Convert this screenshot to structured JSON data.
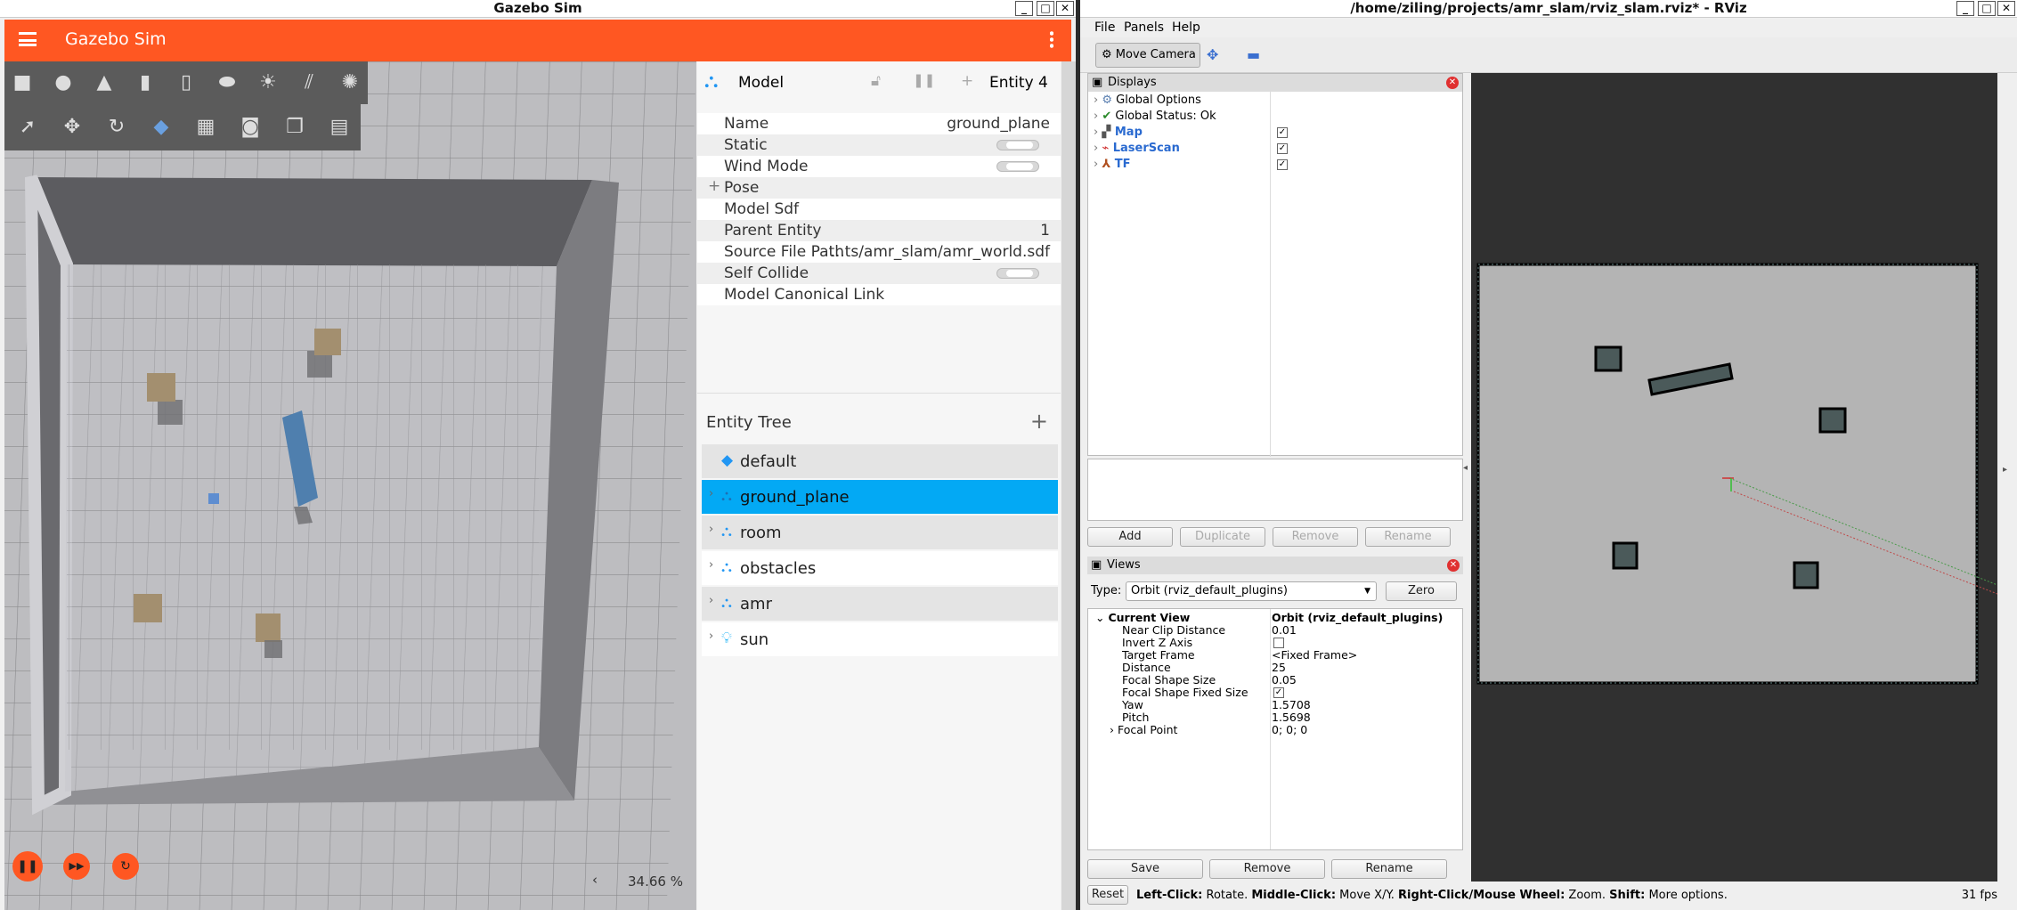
{
  "gazebo": {
    "window_title": "Gazebo Sim",
    "app_title": "Gazebo Sim",
    "zoom": "34.66 %",
    "props": {
      "header": "Model",
      "entity": "Entity 4",
      "rows": [
        {
          "key": "Name",
          "value": "ground_plane"
        },
        {
          "key": "Static",
          "value": ""
        },
        {
          "key": "Wind Mode",
          "value": ""
        },
        {
          "key": "Pose",
          "value": ""
        },
        {
          "key": "Model Sdf",
          "value": ""
        },
        {
          "key": "Parent Entity",
          "value": "1"
        },
        {
          "key": "Source File Path",
          "value": "...ts/amr_slam/amr_world.sdf"
        },
        {
          "key": "Self Collide",
          "value": ""
        },
        {
          "key": "Model Canonical Link",
          "value": ""
        }
      ]
    },
    "entity_tree": {
      "title": "Entity Tree",
      "items": [
        "default",
        "ground_plane",
        "room",
        "obstacles",
        "amr",
        "sun"
      ],
      "selected": "ground_plane"
    }
  },
  "rviz": {
    "window_title": "/home/ziling/projects/amr_slam/rviz_slam.rviz* - RViz",
    "menu": [
      "File",
      "Panels",
      "Help"
    ],
    "tool_move_camera": "Move Camera",
    "displays": {
      "title": "Displays",
      "items": [
        "Global Options",
        "Global Status: Ok",
        "Map",
        "LaserScan",
        "TF"
      ],
      "buttons": [
        "Add",
        "Duplicate",
        "Remove",
        "Rename"
      ]
    },
    "views": {
      "title": "Views",
      "type_label": "Type:",
      "type_value": "Orbit (rviz_default_plugins)",
      "zero": "Zero",
      "current_view": "Current View",
      "current_view_value": "Orbit (rviz_default_plugins)",
      "rows": [
        {
          "key": "Near Clip Distance",
          "value": "0.01"
        },
        {
          "key": "Invert Z Axis",
          "value": ""
        },
        {
          "key": "Target Frame",
          "value": "<Fixed Frame>"
        },
        {
          "key": "Distance",
          "value": "25"
        },
        {
          "key": "Focal Shape Size",
          "value": "0.05"
        },
        {
          "key": "Focal Shape Fixed Size",
          "value": ""
        },
        {
          "key": "Yaw",
          "value": "1.5708"
        },
        {
          "key": "Pitch",
          "value": "1.5698"
        },
        {
          "key": "Focal Point",
          "value": "0; 0; 0"
        }
      ],
      "buttons": [
        "Save",
        "Remove",
        "Rename"
      ]
    },
    "status": {
      "reset": "Reset",
      "b1": "Left-Click:",
      "t1": " Rotate. ",
      "b2": "Middle-Click:",
      "t2": " Move X/Y. ",
      "b3": "Right-Click/Mouse Wheel:",
      "t3": " Zoom. ",
      "b4": "Shift:",
      "t4": " More options.",
      "fps": "31 fps"
    }
  }
}
